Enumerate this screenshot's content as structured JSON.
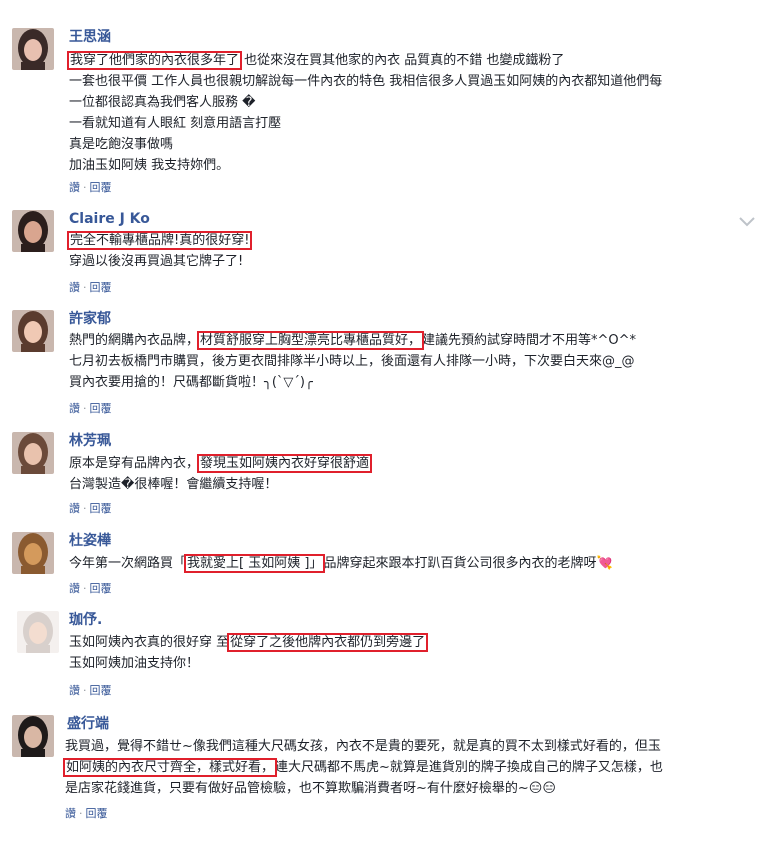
{
  "actions": {
    "like": "讚",
    "sep": "·",
    "reply": "回覆"
  },
  "comments": [
    {
      "name": "王思涵",
      "lines": [
        {
          "pre": "",
          "hl": "我穿了他們家的內衣很多年了",
          "post": " 也從來沒在買其他家的內衣 品質真的不錯 也變成鐵粉了"
        },
        {
          "pre": "一套也很平價 工作人員也很親切解說每一件內衣的特色 我相信很多人買過玉如阿姨的內衣都知道他們每",
          "hl": "",
          "post": ""
        },
        {
          "pre": "一位都很認真為我們客人服務 �",
          "hl": "",
          "post": ""
        },
        {
          "pre": "一看就知道有人眼紅 刻意用語言打壓",
          "hl": "",
          "post": ""
        },
        {
          "pre": "真是吃飽沒事做嗎",
          "hl": "",
          "post": ""
        },
        {
          "pre": "加油玉如阿姨 我支持妳們。",
          "hl": "",
          "post": ""
        }
      ]
    },
    {
      "name": "Claire J Ko",
      "lines": [
        {
          "pre": "",
          "hl": "完全不輸專櫃品牌!真的很好穿!",
          "post": ""
        },
        {
          "pre": "穿過以後沒再買過其它牌子了!",
          "hl": "",
          "post": ""
        }
      ]
    },
    {
      "name": "許家郁",
      "lines": [
        {
          "pre": "熱門的網購內衣品牌，",
          "hl": "材質舒服穿上胸型漂亮比專櫃品質好，",
          "post": "建議先預約試穿時間才不用等*^O^*"
        },
        {
          "pre": "七月初去板橋門市購買，後方更衣間排隊半小時以上，後面還有人排隊一小時，下次要白天來@_@",
          "hl": "",
          "post": ""
        },
        {
          "pre": "買內衣要用搶的！尺碼都斷貨啦！╮(ˋ▽ˊ)╭",
          "hl": "",
          "post": ""
        }
      ]
    },
    {
      "name": "林芳珮",
      "lines": [
        {
          "pre": "原本是穿有品牌內衣，",
          "hl": "發現玉如阿姨內衣好穿很舒適",
          "post": ""
        },
        {
          "pre": "台灣製造�很棒喔！會繼續支持喔！",
          "hl": "",
          "post": ""
        }
      ]
    },
    {
      "name": "杜姿樺",
      "lines": [
        {
          "pre": "今年第一次網路買「",
          "hl": "我就愛上[ 玉如阿姨 ]」",
          "post": "品牌穿起來跟本打趴百貨公司很多內衣的老牌呀💘"
        }
      ]
    },
    {
      "name": "珈伃.",
      "lines": [
        {
          "pre": "玉如阿姨內衣真的很好穿 至",
          "hl": "從穿了之後他牌內衣都仍到旁邊了",
          "post": ""
        },
        {
          "pre": "玉如阿姨加油支持你！",
          "hl": "",
          "post": ""
        }
      ]
    },
    {
      "name": "盛行端",
      "lines": [
        {
          "pre": "我買過，覺得不錯ㄝ~像我們這種大尺碼女孩，內衣不是貴的要死，就是真的買不太到樣式好看的，但玉",
          "hl": "",
          "post": ""
        },
        {
          "pre": "",
          "hl": "如阿姨的內衣尺寸齊全，樣式好看，",
          "post": "連大尺碼都不馬虎~就算是進貨別的牌子換成自己的牌子又怎樣，也"
        },
        {
          "pre": "是店家花錢進貨，只要有做好品管檢驗，也不算欺騙消費者呀~有什麼好檢舉的~😑😑",
          "hl": "",
          "post": ""
        }
      ]
    }
  ]
}
